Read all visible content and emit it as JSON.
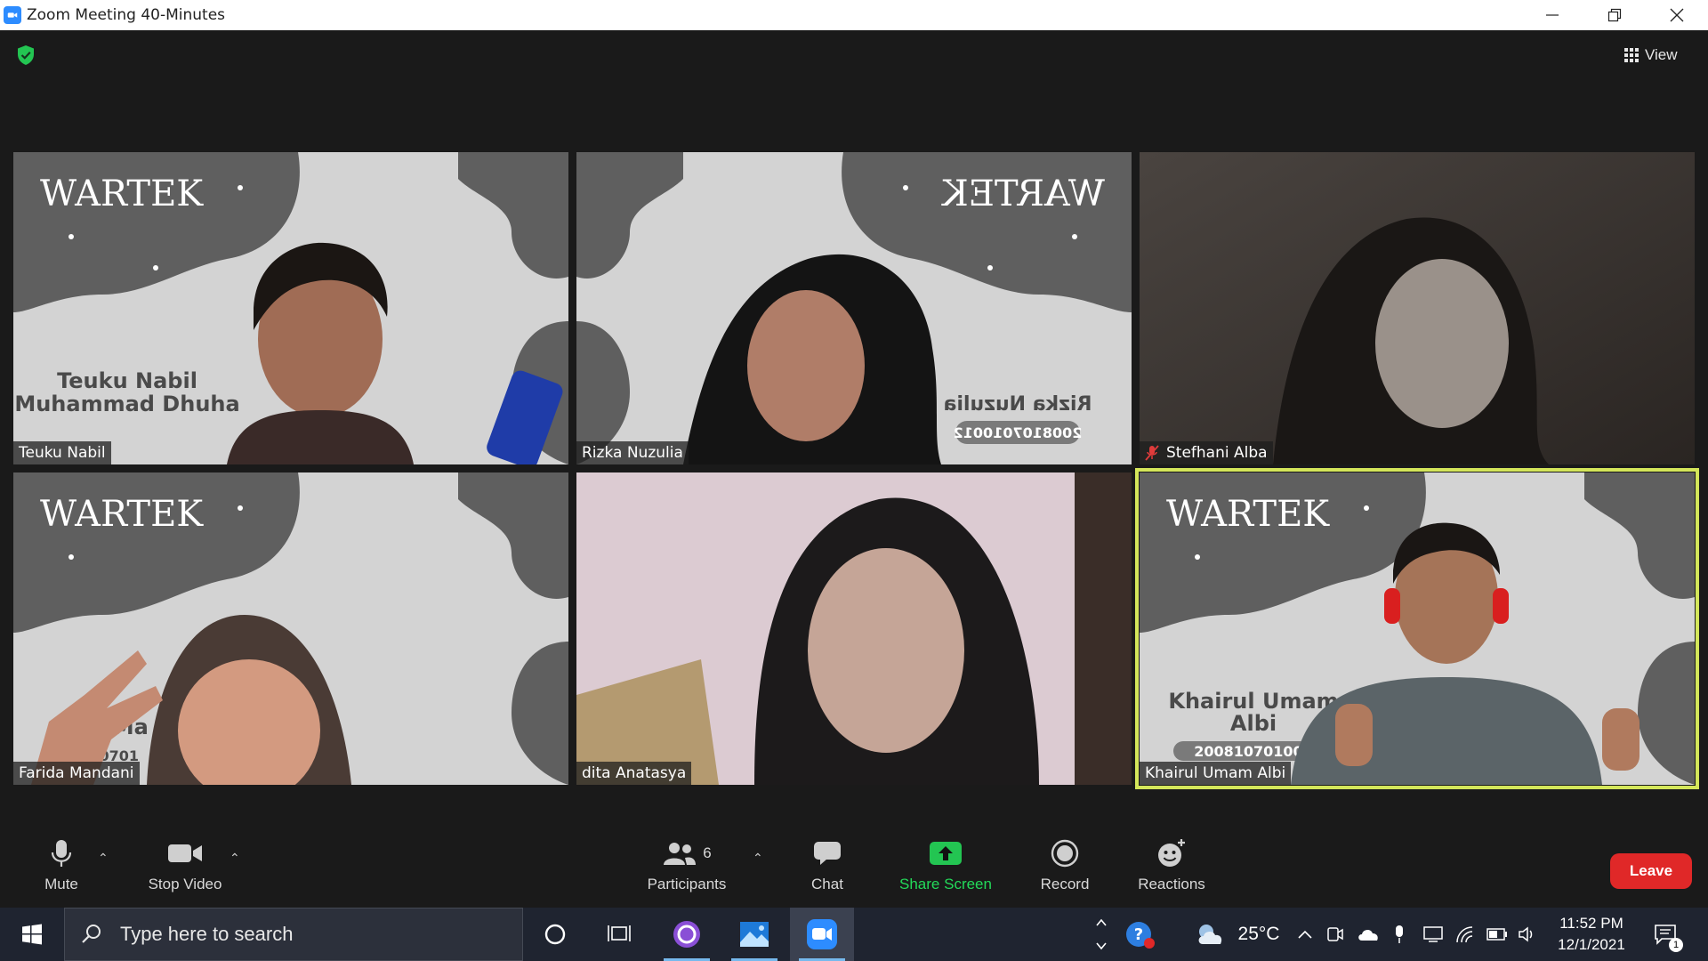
{
  "window": {
    "title": "Zoom Meeting 40-Minutes"
  },
  "header": {
    "view_label": "View"
  },
  "participants_tiles": [
    {
      "name": "Teuku Nabil",
      "background_text_1": "Teuku Nabil",
      "background_text_2": "Muhammad Dhuha",
      "muted": false
    },
    {
      "name": "Rizka Nuzulia",
      "background_text_1": "Rizka Nuzulia",
      "background_text_2": "2008107010012",
      "muted": false
    },
    {
      "name": "Stefhani Alba",
      "muted": true
    },
    {
      "name": "Farida Mandani",
      "background_text_1": "da Ma",
      "background_text_2": "00810701",
      "muted": false
    },
    {
      "name": "dita Anatasya",
      "muted": false
    },
    {
      "name": "Khairul Umam Albi",
      "background_text_1": "Khairul Umam",
      "background_text_2": "Albi",
      "background_text_3": "200810701007",
      "muted": false,
      "active_speaker": true
    }
  ],
  "logo_text": "WARTEK",
  "toolbar": {
    "mute_label": "Mute",
    "stop_video_label": "Stop Video",
    "participants_label": "Participants",
    "participants_count": "6",
    "chat_label": "Chat",
    "share_screen_label": "Share Screen",
    "record_label": "Record",
    "reactions_label": "Reactions",
    "leave_label": "Leave"
  },
  "taskbar": {
    "search_placeholder": "Type here to search",
    "temperature": "25°C",
    "time": "11:52 PM",
    "date": "12/1/2021",
    "notifications_count": "1"
  },
  "colors": {
    "active_speaker_border": "#d4e65a",
    "share_green": "#23d959",
    "leave_red": "#e02828"
  }
}
